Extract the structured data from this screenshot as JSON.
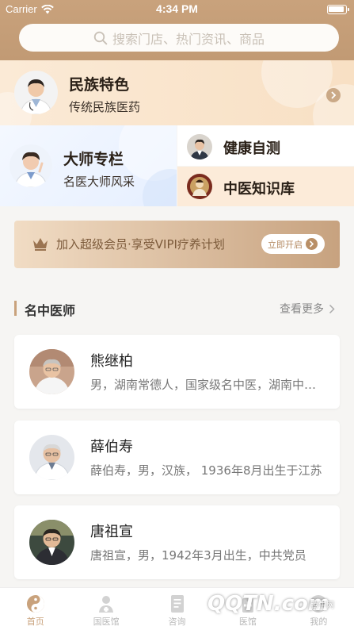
{
  "status_bar": {
    "carrier": "Carrier",
    "time": "4:34 PM"
  },
  "search": {
    "placeholder": "搜索门店、热门资讯、商品"
  },
  "features": {
    "ethnic": {
      "title": "民族特色",
      "subtitle": "传统民族医药"
    },
    "master": {
      "title": "大师专栏",
      "subtitle": "名医大师风采"
    },
    "self_test": {
      "title": "健康自测"
    },
    "knowledge": {
      "title": "中医知识库"
    }
  },
  "vip": {
    "text": "加入超级会员·享受VIPI疗养计划",
    "button": "立即开启"
  },
  "section": {
    "title": "名中医师",
    "more": "查看更多"
  },
  "doctors": [
    {
      "name": "熊继柏",
      "desc": "男，湖南常德人，国家级名中医，湖南中医药大学教授"
    },
    {
      "name": "薛伯寿",
      "desc": "薛伯寿，男，汉族， 1936年8月出生于江苏"
    },
    {
      "name": "唐祖宣",
      "desc": "唐祖宣，男，1942年3月出生，中共党员"
    }
  ],
  "tabs": [
    {
      "label": "首页",
      "icon": "yin-yang-icon",
      "active": true
    },
    {
      "label": "国医馆",
      "icon": "doctor-icon",
      "active": false
    },
    {
      "label": "咨询",
      "icon": "document-icon",
      "active": false
    },
    {
      "label": "医馆",
      "icon": "medicine-icon",
      "active": false
    },
    {
      "label": "我的",
      "icon": "user-icon",
      "active": false
    }
  ],
  "watermark": {
    "logo": "QQTN.com",
    "site": "腾牛网"
  },
  "colors": {
    "brand": "#c9a27c",
    "header": "#c19a74",
    "background": "#f6f5f3"
  }
}
